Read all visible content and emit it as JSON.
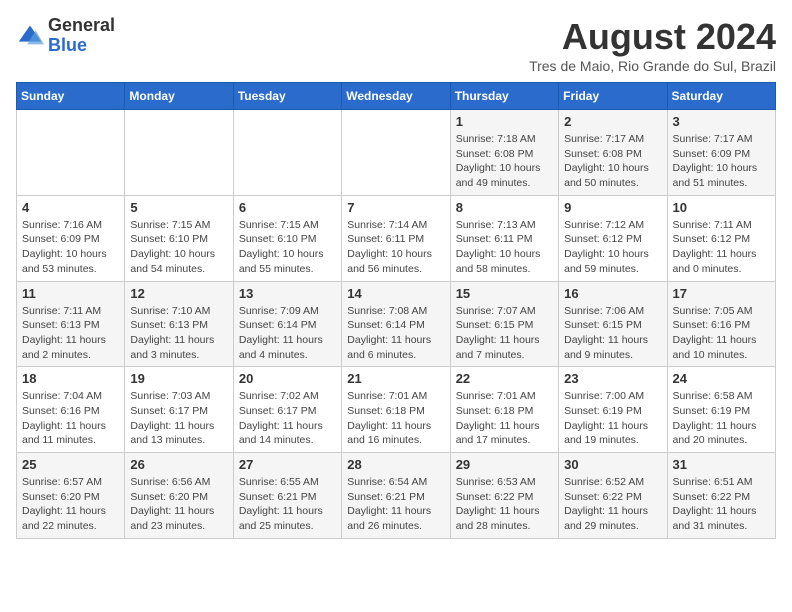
{
  "header": {
    "logo_line1": "General",
    "logo_line2": "Blue",
    "month": "August 2024",
    "location": "Tres de Maio, Rio Grande do Sul, Brazil"
  },
  "weekdays": [
    "Sunday",
    "Monday",
    "Tuesday",
    "Wednesday",
    "Thursday",
    "Friday",
    "Saturday"
  ],
  "weeks": [
    [
      {
        "day": "",
        "info": ""
      },
      {
        "day": "",
        "info": ""
      },
      {
        "day": "",
        "info": ""
      },
      {
        "day": "",
        "info": ""
      },
      {
        "day": "1",
        "info": "Sunrise: 7:18 AM\nSunset: 6:08 PM\nDaylight: 10 hours\nand 49 minutes."
      },
      {
        "day": "2",
        "info": "Sunrise: 7:17 AM\nSunset: 6:08 PM\nDaylight: 10 hours\nand 50 minutes."
      },
      {
        "day": "3",
        "info": "Sunrise: 7:17 AM\nSunset: 6:09 PM\nDaylight: 10 hours\nand 51 minutes."
      }
    ],
    [
      {
        "day": "4",
        "info": "Sunrise: 7:16 AM\nSunset: 6:09 PM\nDaylight: 10 hours\nand 53 minutes."
      },
      {
        "day": "5",
        "info": "Sunrise: 7:15 AM\nSunset: 6:10 PM\nDaylight: 10 hours\nand 54 minutes."
      },
      {
        "day": "6",
        "info": "Sunrise: 7:15 AM\nSunset: 6:10 PM\nDaylight: 10 hours\nand 55 minutes."
      },
      {
        "day": "7",
        "info": "Sunrise: 7:14 AM\nSunset: 6:11 PM\nDaylight: 10 hours\nand 56 minutes."
      },
      {
        "day": "8",
        "info": "Sunrise: 7:13 AM\nSunset: 6:11 PM\nDaylight: 10 hours\nand 58 minutes."
      },
      {
        "day": "9",
        "info": "Sunrise: 7:12 AM\nSunset: 6:12 PM\nDaylight: 10 hours\nand 59 minutes."
      },
      {
        "day": "10",
        "info": "Sunrise: 7:11 AM\nSunset: 6:12 PM\nDaylight: 11 hours\nand 0 minutes."
      }
    ],
    [
      {
        "day": "11",
        "info": "Sunrise: 7:11 AM\nSunset: 6:13 PM\nDaylight: 11 hours\nand 2 minutes."
      },
      {
        "day": "12",
        "info": "Sunrise: 7:10 AM\nSunset: 6:13 PM\nDaylight: 11 hours\nand 3 minutes."
      },
      {
        "day": "13",
        "info": "Sunrise: 7:09 AM\nSunset: 6:14 PM\nDaylight: 11 hours\nand 4 minutes."
      },
      {
        "day": "14",
        "info": "Sunrise: 7:08 AM\nSunset: 6:14 PM\nDaylight: 11 hours\nand 6 minutes."
      },
      {
        "day": "15",
        "info": "Sunrise: 7:07 AM\nSunset: 6:15 PM\nDaylight: 11 hours\nand 7 minutes."
      },
      {
        "day": "16",
        "info": "Sunrise: 7:06 AM\nSunset: 6:15 PM\nDaylight: 11 hours\nand 9 minutes."
      },
      {
        "day": "17",
        "info": "Sunrise: 7:05 AM\nSunset: 6:16 PM\nDaylight: 11 hours\nand 10 minutes."
      }
    ],
    [
      {
        "day": "18",
        "info": "Sunrise: 7:04 AM\nSunset: 6:16 PM\nDaylight: 11 hours\nand 11 minutes."
      },
      {
        "day": "19",
        "info": "Sunrise: 7:03 AM\nSunset: 6:17 PM\nDaylight: 11 hours\nand 13 minutes."
      },
      {
        "day": "20",
        "info": "Sunrise: 7:02 AM\nSunset: 6:17 PM\nDaylight: 11 hours\nand 14 minutes."
      },
      {
        "day": "21",
        "info": "Sunrise: 7:01 AM\nSunset: 6:18 PM\nDaylight: 11 hours\nand 16 minutes."
      },
      {
        "day": "22",
        "info": "Sunrise: 7:01 AM\nSunset: 6:18 PM\nDaylight: 11 hours\nand 17 minutes."
      },
      {
        "day": "23",
        "info": "Sunrise: 7:00 AM\nSunset: 6:19 PM\nDaylight: 11 hours\nand 19 minutes."
      },
      {
        "day": "24",
        "info": "Sunrise: 6:58 AM\nSunset: 6:19 PM\nDaylight: 11 hours\nand 20 minutes."
      }
    ],
    [
      {
        "day": "25",
        "info": "Sunrise: 6:57 AM\nSunset: 6:20 PM\nDaylight: 11 hours\nand 22 minutes."
      },
      {
        "day": "26",
        "info": "Sunrise: 6:56 AM\nSunset: 6:20 PM\nDaylight: 11 hours\nand 23 minutes."
      },
      {
        "day": "27",
        "info": "Sunrise: 6:55 AM\nSunset: 6:21 PM\nDaylight: 11 hours\nand 25 minutes."
      },
      {
        "day": "28",
        "info": "Sunrise: 6:54 AM\nSunset: 6:21 PM\nDaylight: 11 hours\nand 26 minutes."
      },
      {
        "day": "29",
        "info": "Sunrise: 6:53 AM\nSunset: 6:22 PM\nDaylight: 11 hours\nand 28 minutes."
      },
      {
        "day": "30",
        "info": "Sunrise: 6:52 AM\nSunset: 6:22 PM\nDaylight: 11 hours\nand 29 minutes."
      },
      {
        "day": "31",
        "info": "Sunrise: 6:51 AM\nSunset: 6:22 PM\nDaylight: 11 hours\nand 31 minutes."
      }
    ]
  ]
}
